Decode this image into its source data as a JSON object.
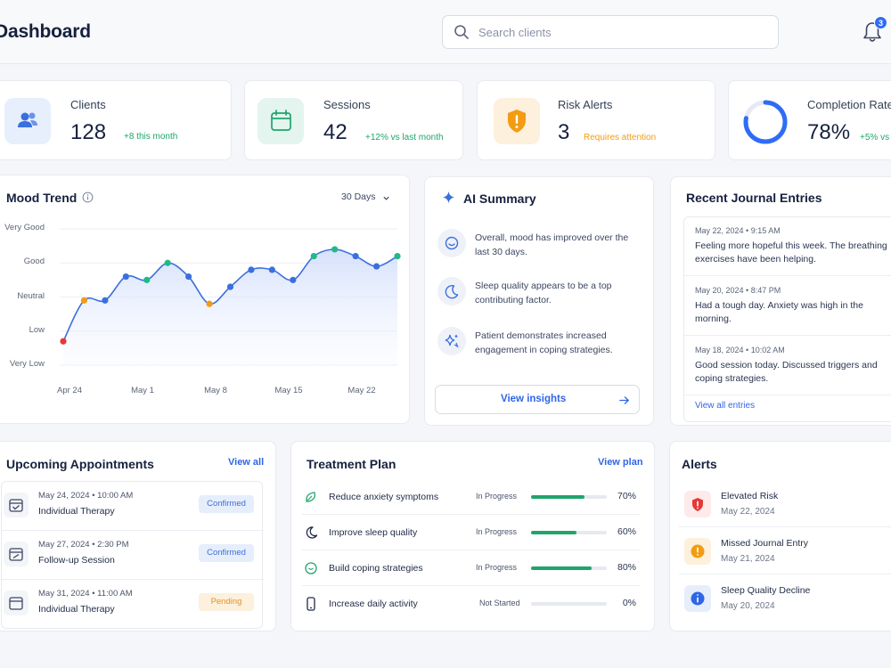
{
  "header": {
    "title": "Dashboard",
    "search_placeholder": "Search clients",
    "notification_count": "3"
  },
  "stats": [
    {
      "label": "Clients",
      "value": "128",
      "delta": "+8 this month",
      "icon": "users-icon",
      "delta_color": "#1fa56b"
    },
    {
      "label": "Sessions",
      "value": "42",
      "delta": "+12% vs last month",
      "icon": "calendar-icon",
      "delta_color": "#1fa56b"
    },
    {
      "label": "Risk Alerts",
      "value": "3",
      "delta": "Requires attention",
      "icon": "shield-alert-icon",
      "delta_color": "#f39c12"
    },
    {
      "label": "Completion Rate",
      "value": "78%",
      "delta": "+5% vs",
      "icon": "progress-ring-icon",
      "delta_color": "#1fa56b",
      "progress": 0.78
    }
  ],
  "mood": {
    "title": "Mood Trend",
    "range_label": "30 Days",
    "y_labels": [
      "Very Good",
      "Good",
      "Neutral",
      "Low",
      "Very Low"
    ],
    "x_labels": [
      "Apr 24",
      "May 1",
      "May 8",
      "May 15",
      "May 22"
    ]
  },
  "chart_data": {
    "type": "line",
    "title": "Mood Trend",
    "y_categories": [
      "Very Low",
      "Low",
      "Neutral",
      "Good",
      "Very Good"
    ],
    "ylim": [
      0,
      4
    ],
    "x": [
      "Apr 24",
      "Apr 26",
      "Apr 28",
      "Apr 30",
      "May 2",
      "May 4",
      "May 6",
      "May 8",
      "May 10",
      "May 12",
      "May 14",
      "May 16",
      "May 18",
      "May 20",
      "May 22",
      "May 24",
      "May 26"
    ],
    "values": [
      0.7,
      1.6,
      1.9,
      2.1,
      2.0,
      2.4,
      2.5,
      2.3,
      2.7,
      2.2,
      2.5,
      2.9,
      2.5,
      2.6,
      2.9,
      3.1,
      3.1,
      3.3,
      2.8,
      3.3,
      3.0,
      2.5
    ],
    "points": [
      {
        "x": "Apr 24",
        "value": 0.7,
        "color": "#e53935"
      },
      {
        "x": "Apr 29",
        "value": 1.9,
        "color": "#f39c12"
      },
      {
        "x": "May 1",
        "value": 1.9,
        "color": "#3b6fe0"
      },
      {
        "x": "May 3",
        "value": 2.6,
        "color": "#3b6fe0"
      },
      {
        "x": "May 5",
        "value": 2.5,
        "color": "#1fb98c"
      },
      {
        "x": "May 6",
        "value": 3.0,
        "color": "#1fb98c"
      },
      {
        "x": "May 8",
        "value": 2.6,
        "color": "#3b6fe0"
      },
      {
        "x": "May 10",
        "value": 1.8,
        "color": "#f39c12"
      },
      {
        "x": "May 12",
        "value": 2.3,
        "color": "#3b6fe0"
      },
      {
        "x": "May 14",
        "value": 2.8,
        "color": "#3b6fe0"
      },
      {
        "x": "May 15",
        "value": 2.8,
        "color": "#3b6fe0"
      },
      {
        "x": "May 17",
        "value": 2.5,
        "color": "#3b6fe0"
      },
      {
        "x": "May 20",
        "value": 3.2,
        "color": "#1fb98c"
      },
      {
        "x": "May 23",
        "value": 3.4,
        "color": "#1fb98c"
      },
      {
        "x": "May 24",
        "value": 3.2,
        "color": "#3b6fe0"
      },
      {
        "x": "May 25",
        "value": 2.9,
        "color": "#3b6fe0"
      },
      {
        "x": "May 27",
        "value": 3.2,
        "color": "#1fb98c"
      }
    ],
    "grid": true,
    "area_fill": true
  },
  "ai": {
    "title": "AI Summary",
    "items": [
      {
        "text": "Overall, mood has improved over the last 30 days.",
        "icon": "smile-icon"
      },
      {
        "text": "Sleep quality appears to be a top contributing factor.",
        "icon": "moon-icon"
      },
      {
        "text": "Patient demonstrates increased engagement in coping strategies.",
        "icon": "sparkle-icon"
      }
    ],
    "button_label": "View insights"
  },
  "journal": {
    "title": "Recent Journal Entries",
    "entries": [
      {
        "date": "May 22, 2024  •  9:15 AM",
        "text": "Feeling more hopeful this week. The breathing exercises have been helping."
      },
      {
        "date": "May 20, 2024  •  8:47 PM",
        "text": "Had a tough day. Anxiety was high in the morning."
      },
      {
        "date": "May 18, 2024  •  10:02 AM",
        "text": "Good session today. Discussed triggers and coping strategies."
      }
    ],
    "view_all": "View all entries"
  },
  "appointments": {
    "title": "Upcoming Appointments",
    "view_all": "View all",
    "items": [
      {
        "date": "May 24, 2024  •  10:00 AM",
        "type": "Individual Therapy",
        "status": "Confirmed",
        "status_bg": "#e6eefc",
        "status_fg": "#3d6fd8"
      },
      {
        "date": "May 27, 2024  •  2:30 PM",
        "type": "Follow-up Session",
        "status": "Confirmed",
        "status_bg": "#e6eefc",
        "status_fg": "#3d6fd8"
      },
      {
        "date": "May 31, 2024  •  11:00 AM",
        "type": "Individual Therapy",
        "status": "Pending",
        "status_bg": "#fdf0dc",
        "status_fg": "#e3932b"
      }
    ]
  },
  "treatment": {
    "title": "Treatment Plan",
    "view_plan": "View plan",
    "items": [
      {
        "name": "Reduce anxiety symptoms",
        "status": "In Progress",
        "progress": 0.7,
        "pct": "70%",
        "icon": "leaf-icon"
      },
      {
        "name": "Improve sleep quality",
        "status": "In Progress",
        "progress": 0.6,
        "pct": "60%",
        "icon": "moon-icon"
      },
      {
        "name": "Build coping strategies",
        "status": "In Progress",
        "progress": 0.8,
        "pct": "80%",
        "icon": "heart-icon"
      },
      {
        "name": "Increase daily activity",
        "status": "Not Started",
        "progress": 0.0,
        "pct": "0%",
        "icon": "phone-icon"
      }
    ]
  },
  "alerts": {
    "title": "Alerts",
    "items": [
      {
        "title": "Elevated Risk",
        "date": "May 22, 2024",
        "icon": "shield-alert-icon",
        "bg": "#fdeaea",
        "color": "#e53935"
      },
      {
        "title": "Missed Journal Entry",
        "date": "May 21, 2024",
        "icon": "exclamation-icon",
        "bg": "#fdf0dc",
        "color": "#f39c12"
      },
      {
        "title": "Sleep Quality Decline",
        "date": "May 20, 2024",
        "icon": "info-icon",
        "bg": "#e6eefc",
        "color": "#2f66e6"
      }
    ]
  }
}
